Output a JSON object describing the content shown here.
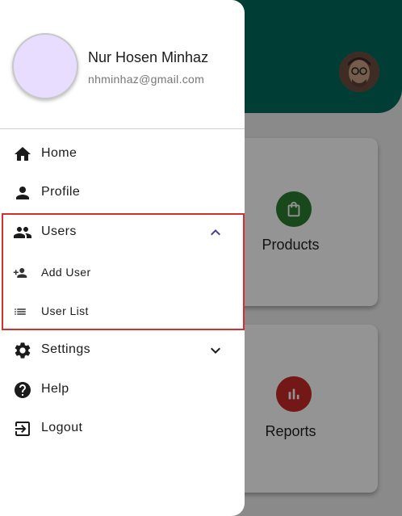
{
  "profile": {
    "name": "Nur Hosen Minhaz",
    "email": "nhminhaz@gmail.com"
  },
  "menu": {
    "home": "Home",
    "profile": "Profile",
    "users": "Users",
    "add_user": "Add User",
    "user_list": "User List",
    "settings": "Settings",
    "help": "Help",
    "logout": "Logout"
  },
  "cards": {
    "products": "Products",
    "reports": "Reports"
  },
  "icons": {
    "home": "home-icon",
    "profile": "person-icon",
    "users": "people-icon",
    "add_user": "person-add-icon",
    "user_list": "list-icon",
    "settings": "gear-icon",
    "help": "help-icon",
    "logout": "logout-icon"
  },
  "colors": {
    "header": "#00695c",
    "products_icon": "#2e7d32",
    "reports_icon": "#c62828",
    "highlight": "#d32f2f",
    "expand_chevron": "#4a3f8c"
  }
}
